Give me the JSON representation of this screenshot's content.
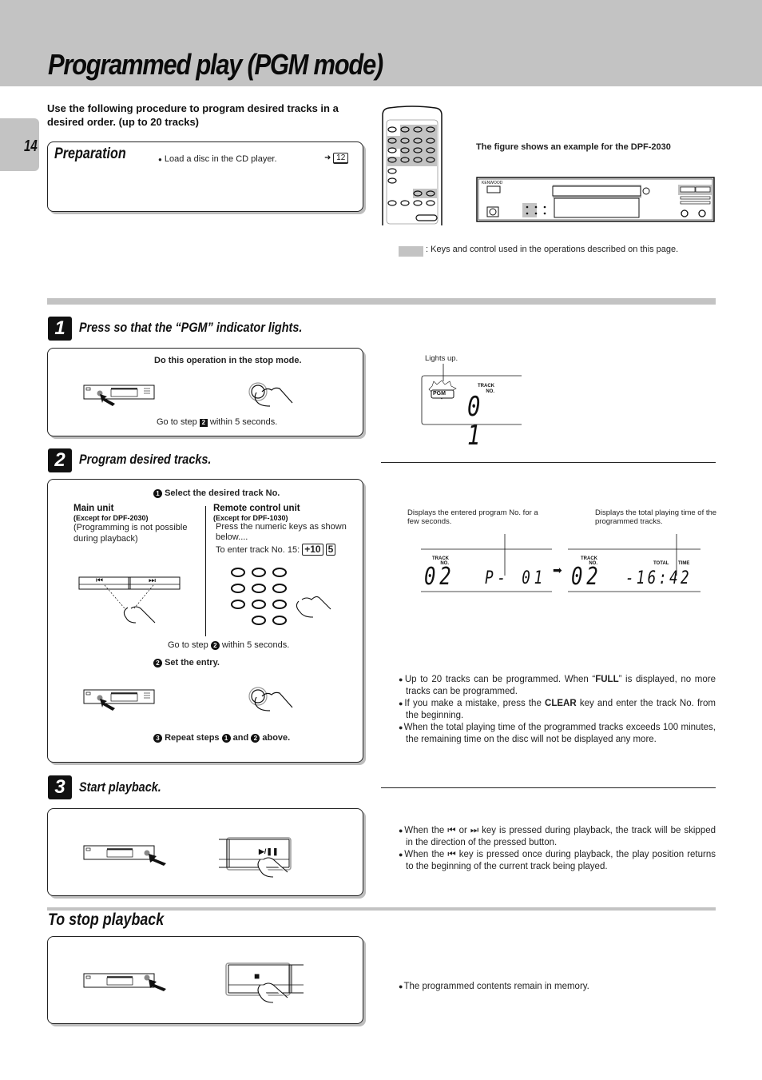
{
  "header": {
    "title": "Programmed play (PGM mode)",
    "page_number": "14"
  },
  "intro": "Use the following procedure to program desired tracks in a desired order. (up to 20 tracks)",
  "preparation": {
    "heading": "Preparation",
    "item": "Load a disc in the CD player.",
    "page_ref": "12"
  },
  "figure": {
    "caption": "The figure shows an example for the DPF-2030",
    "brand": "KENWOOD",
    "legend": ": Keys and control used in the operations described on this page."
  },
  "step1": {
    "number": "1",
    "heading": "Press so that the “PGM” indicator lights.",
    "note": "Do this operation in the stop mode.",
    "goto_prefix": "Go to step",
    "goto_step": "2",
    "goto_suffix": "within 5 seconds.",
    "display": {
      "callout": "Lights up.",
      "pgm_label": "PGM",
      "track_label_1": "TRACK",
      "track_label_2": "NO.",
      "digits": "0 1"
    }
  },
  "step2": {
    "number": "2",
    "heading": "Program desired tracks.",
    "sub1_num": "1",
    "sub1": "Select the desired track No.",
    "main_unit": {
      "title": "Main unit",
      "except": "(Except for DPF-2030)",
      "note": "(Programming is not possible during playback)",
      "prev_key": "⏮",
      "next_key": "⏭"
    },
    "remote": {
      "title": "Remote control unit",
      "except": "(Except for DPF-1030)",
      "note": "Press the numeric keys as shown below....",
      "example_prefix": "To enter track No. 15:",
      "key1": "+10",
      "key2": "5"
    },
    "goto_prefix": "Go to step",
    "goto_step": "2",
    "goto_suffix": "within 5 seconds.",
    "sub2_num": "2",
    "sub2": "Set the entry.",
    "sub3_num": "3",
    "sub3_a": "Repeat steps",
    "sub3_s1": "1",
    "sub3_and": "and",
    "sub3_s2": "2",
    "sub3_b": "above.",
    "displays": {
      "left_caption": "Displays the entered program No. for a few seconds.",
      "right_caption": "Displays the total playing time of the programmed tracks.",
      "track_label_1": "TRACK",
      "track_label_2": "NO.",
      "left_track": "02",
      "left_value": "P- 01",
      "right_track": "02",
      "right_value": "-16:42",
      "total_label": "TOTAL",
      "time_label": "TIME"
    },
    "notes": [
      {
        "pre": "Up to 20 tracks can be programmed.  When “",
        "bold": "FULL",
        "post": "” is displayed, no more tracks can be programmed."
      },
      {
        "pre": "If you make a mistake, press the ",
        "bold": "CLEAR",
        "post": " key and enter  the track No. from the beginning."
      },
      {
        "pre": "When the total playing time of the programmed tracks exceeds 100 minutes, the remaining time on the disc will not be displayed any more.",
        "bold": "",
        "post": ""
      }
    ]
  },
  "step3": {
    "number": "3",
    "heading": "Start playback.",
    "key_label": "▶/❚❚",
    "notes": [
      {
        "a": "When the ",
        "k1": "⏮",
        "b": " or ",
        "k2": "⏭",
        "c": " key is pressed during playback,  the track will be skipped in the direction of the  pressed button."
      },
      {
        "a": "When the ",
        "k1": "⏮",
        "b": " key is pressed once during playback, the  play position returns to the beginning of the current  track being played.",
        "k2": "",
        "c": ""
      }
    ]
  },
  "stop": {
    "heading": "To stop playback",
    "key_label": "■",
    "note": "The programmed contents remain in memory."
  }
}
